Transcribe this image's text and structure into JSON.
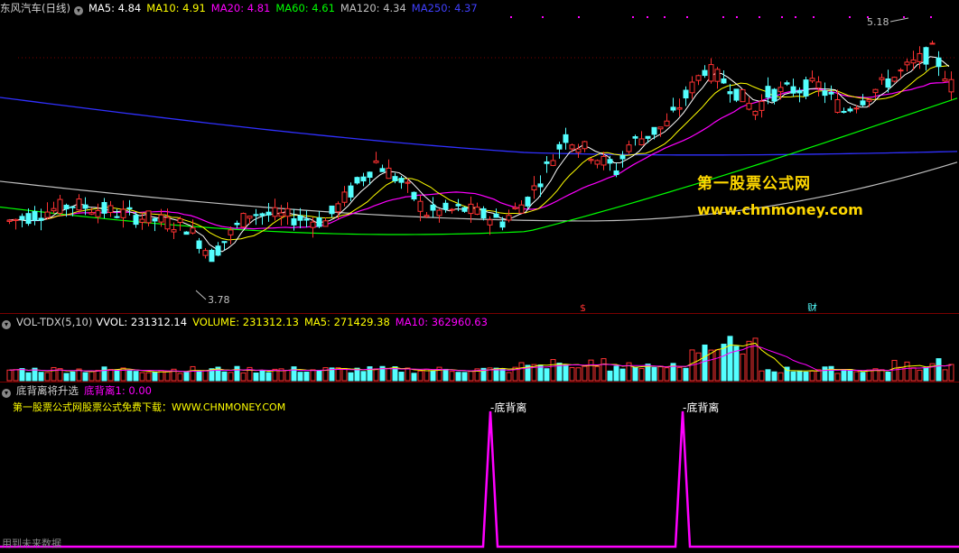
{
  "main_header": {
    "stock_name": "东风汽车(日线)",
    "ma5": "MA5: 4.84",
    "ma10": "MA10: 4.91",
    "ma20": "MA20: 4.81",
    "ma60": "MA60: 4.61",
    "ma120": "MA120: 4.34",
    "ma250": "MA250: 4.37"
  },
  "vol_header": {
    "name": "VOL-TDX(5,10)",
    "vvol": "VVOL: 231312.14",
    "volume": "VOLUME: 231312.13",
    "ma5": "MA5: 271429.38",
    "ma10": "MA10: 362960.63"
  },
  "ind_header": {
    "name": "底背离将升选",
    "value": "底背离1: 0.00"
  },
  "ind_note": "第一股票公式网股票公式免费下载：WWW.CHNMONEY.COM",
  "bottom_note": "用到未来数据",
  "watermark": {
    "line1": "第一股票公式网",
    "line2": "www.chnmoney.com"
  },
  "colors": {
    "up": "#ff3232",
    "down": "#54ffff",
    "ma5": "#ffffff",
    "ma10": "#ffff00",
    "ma20": "#ff00ff",
    "ma60": "#00ff00",
    "ma120": "#c0c0c0",
    "ma250": "#3030ff",
    "signal": "#ff00ff",
    "watermark": "#ffd800"
  },
  "chart_data": {
    "type": "candlestick",
    "price_range": [
      3.78,
      5.18
    ],
    "high_label": "5.18",
    "low_label": "3.78",
    "markers": [
      "$",
      "财"
    ],
    "divergence_label": "底背离",
    "divergence_signals": 2
  }
}
